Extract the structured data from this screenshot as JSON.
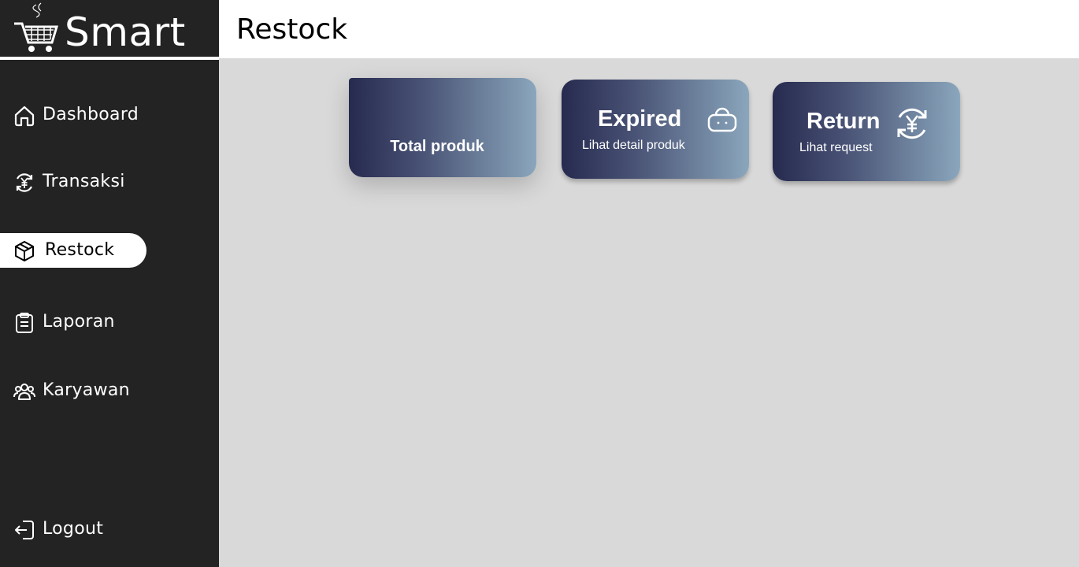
{
  "brand": {
    "name": "Smart",
    "logo_icon": "shopping-cart-icon"
  },
  "sidebar": {
    "items": [
      {
        "label": "Dashboard",
        "icon": "home-icon"
      },
      {
        "label": "Transaksi",
        "icon": "yen-refresh-icon"
      },
      {
        "label": "Restock",
        "icon": "package-icon",
        "active": true
      },
      {
        "label": "Laporan",
        "icon": "clipboard-icon"
      },
      {
        "label": "Karyawan",
        "icon": "users-icon"
      }
    ],
    "logout": {
      "label": "Logout",
      "icon": "logout-icon"
    }
  },
  "header": {
    "title": "Restock"
  },
  "cards": [
    {
      "title": "Total produk",
      "subtitle": ""
    },
    {
      "title": "Expired",
      "subtitle": "Lihat detail produk",
      "icon": "bag-icon"
    },
    {
      "title": "Return",
      "subtitle": "Lihat request",
      "icon": "yen-refresh-icon"
    }
  ],
  "colors": {
    "sidebar_bg": "#232323",
    "main_bg": "#d9d9d9",
    "card_gradient_start": "#262a4f",
    "card_gradient_end": "#8aa6bc"
  }
}
